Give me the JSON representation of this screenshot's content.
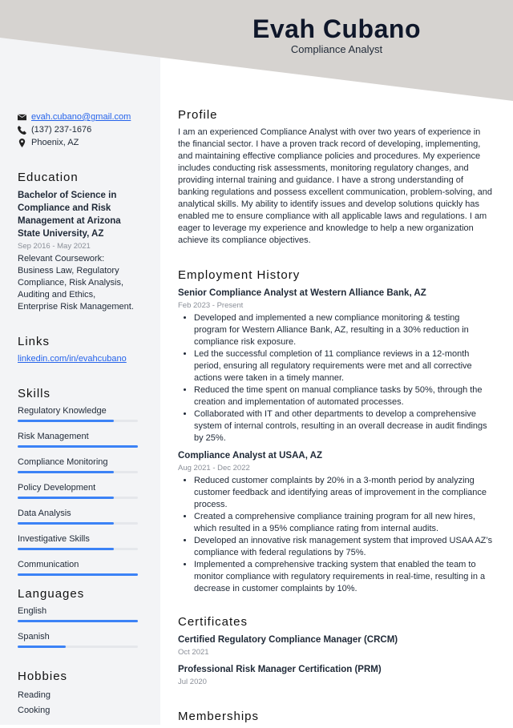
{
  "header": {
    "name": "Evah Cubano",
    "title": "Compliance Analyst",
    "bg_color": "#d6d3d0"
  },
  "contact": {
    "email": "evah.cubano@gmail.com",
    "phone": "(137) 237-1676",
    "location": "Phoenix, AZ",
    "icons": [
      "envelope-icon",
      "phone-icon",
      "map-pin-icon"
    ]
  },
  "education": {
    "heading": "Education",
    "degree": "Bachelor of Science in Compliance and Risk Management at Arizona State University, AZ",
    "dates": "Sep 2016 - May 2021",
    "coursework": "Relevant Coursework: Business Law, Regulatory Compliance, Risk Analysis, Auditing and Ethics, Enterprise Risk Management."
  },
  "links": {
    "heading": "Links",
    "items": [
      "linkedin.com/in/evahcubano"
    ]
  },
  "skills": {
    "heading": "Skills",
    "items": [
      {
        "label": "Regulatory Knowledge",
        "level": 80
      },
      {
        "label": "Risk Management",
        "level": 100
      },
      {
        "label": "Compliance Monitoring",
        "level": 80
      },
      {
        "label": "Policy Development",
        "level": 80
      },
      {
        "label": "Data Analysis",
        "level": 80
      },
      {
        "label": "Investigative Skills",
        "level": 80
      },
      {
        "label": "Communication",
        "level": 100
      }
    ]
  },
  "languages": {
    "heading": "Languages",
    "items": [
      {
        "label": "English",
        "level": 100
      },
      {
        "label": "Spanish",
        "level": 40
      }
    ]
  },
  "hobbies": {
    "heading": "Hobbies",
    "items": [
      "Reading",
      "Cooking"
    ]
  },
  "profile": {
    "heading": "Profile",
    "text": "I am an experienced Compliance Analyst with over two years of experience in the financial sector. I have a proven track record of developing, implementing, and maintaining effective compliance policies and procedures. My experience includes conducting risk assessments, monitoring regulatory changes, and providing internal training and guidance. I have a strong understanding of banking regulations and possess excellent communication, problem-solving, and analytical skills. My ability to identify issues and develop solutions quickly has enabled me to ensure compliance with all applicable laws and regulations. I am eager to leverage my experience and knowledge to help a new organization achieve its compliance objectives."
  },
  "employment": {
    "heading": "Employment History",
    "jobs": [
      {
        "title": "Senior Compliance Analyst at Western Alliance Bank, AZ",
        "dates": "Feb 2023 - Present",
        "bullets": [
          "Developed and implemented a new compliance monitoring & testing program for Western Alliance Bank, AZ, resulting in a 30% reduction in compliance risk exposure.",
          "Led the successful completion of 11 compliance reviews in a 12-month period, ensuring all regulatory requirements were met and all corrective actions were taken in a timely manner.",
          "Reduced the time spent on manual compliance tasks by 50%, through the creation and implementation of automated processes.",
          "Collaborated with IT and other departments to develop a comprehensive system of internal controls, resulting in an overall decrease in audit findings by 25%."
        ]
      },
      {
        "title": "Compliance Analyst at USAA, AZ",
        "dates": "Aug 2021 - Dec 2022",
        "bullets": [
          "Reduced customer complaints by 20% in a 3-month period by analyzing customer feedback and identifying areas of improvement in the compliance process.",
          "Created a comprehensive compliance training program for all new hires, which resulted in a 95% compliance rating from internal audits.",
          "Developed an innovative risk management system that improved USAA AZ’s compliance with federal regulations by 75%.",
          "Implemented a comprehensive tracking system that enabled the team to monitor compliance with regulatory requirements in real-time, resulting in a decrease in customer complaints by 10%."
        ]
      }
    ]
  },
  "certificates": {
    "heading": "Certificates",
    "items": [
      {
        "name": "Certified Regulatory Compliance Manager (CRCM)",
        "date": "Oct 2021"
      },
      {
        "name": "Professional Risk Manager Certification (PRM)",
        "date": "Jul 2020"
      }
    ]
  },
  "memberships": {
    "heading": "Memberships"
  }
}
